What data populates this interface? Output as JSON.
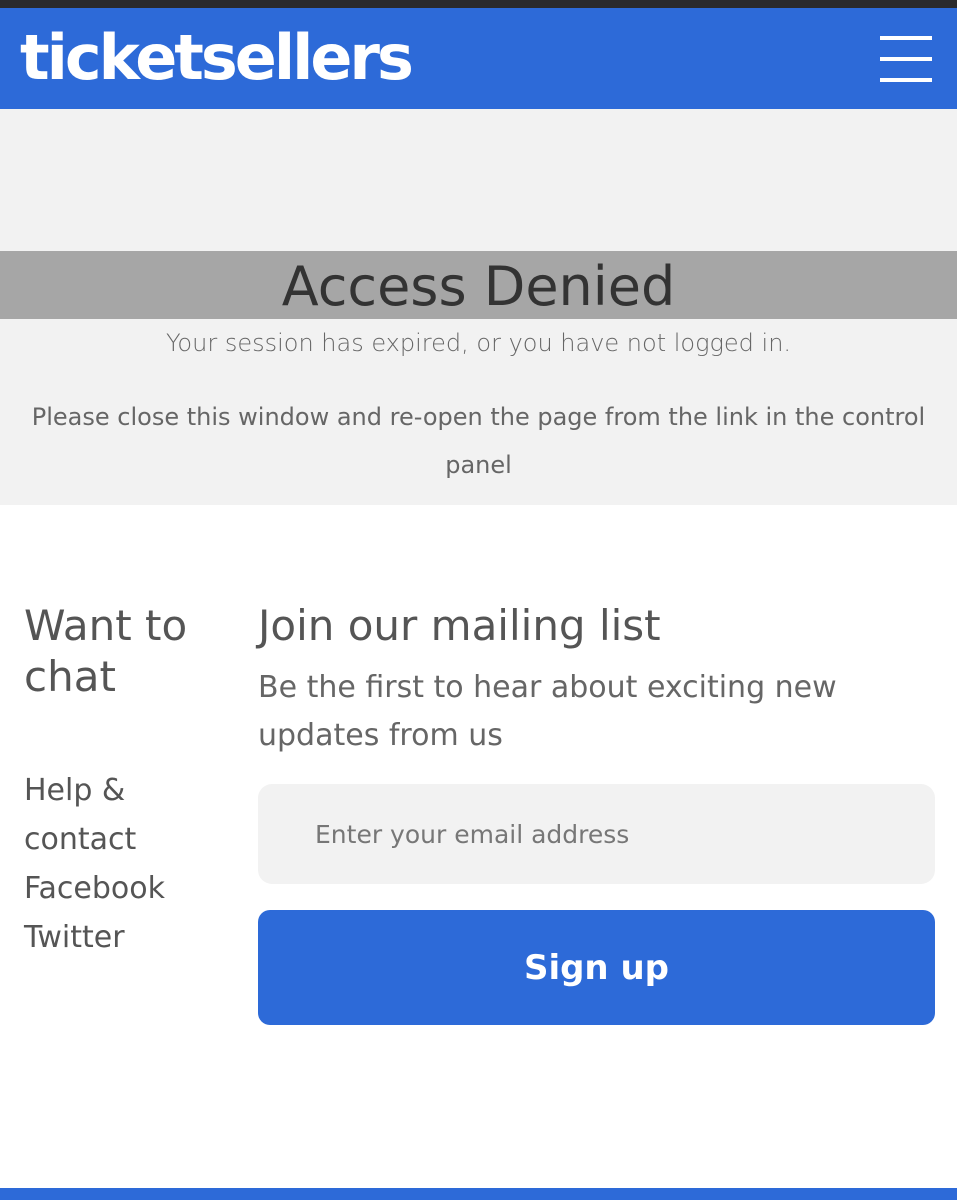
{
  "header": {
    "logo_text": "ticketsellers",
    "menu_icon": "hamburger-menu-icon",
    "brand_color": "#2d6ad8"
  },
  "notice": {
    "title": "Access Denied",
    "message": "Your session has expired, or you have not logged in.",
    "instruction": "Please close this window and re-open the page from the link in the control panel"
  },
  "chat": {
    "title": "Want to chat",
    "links": [
      "Help & contact",
      "Facebook",
      "Twitter"
    ]
  },
  "mailing": {
    "title": "Join our mailing list",
    "subtitle": "Be the first to hear about exciting new updates from us",
    "email_placeholder": "Enter your email address",
    "email_value": "",
    "signup_label": "Sign up"
  }
}
